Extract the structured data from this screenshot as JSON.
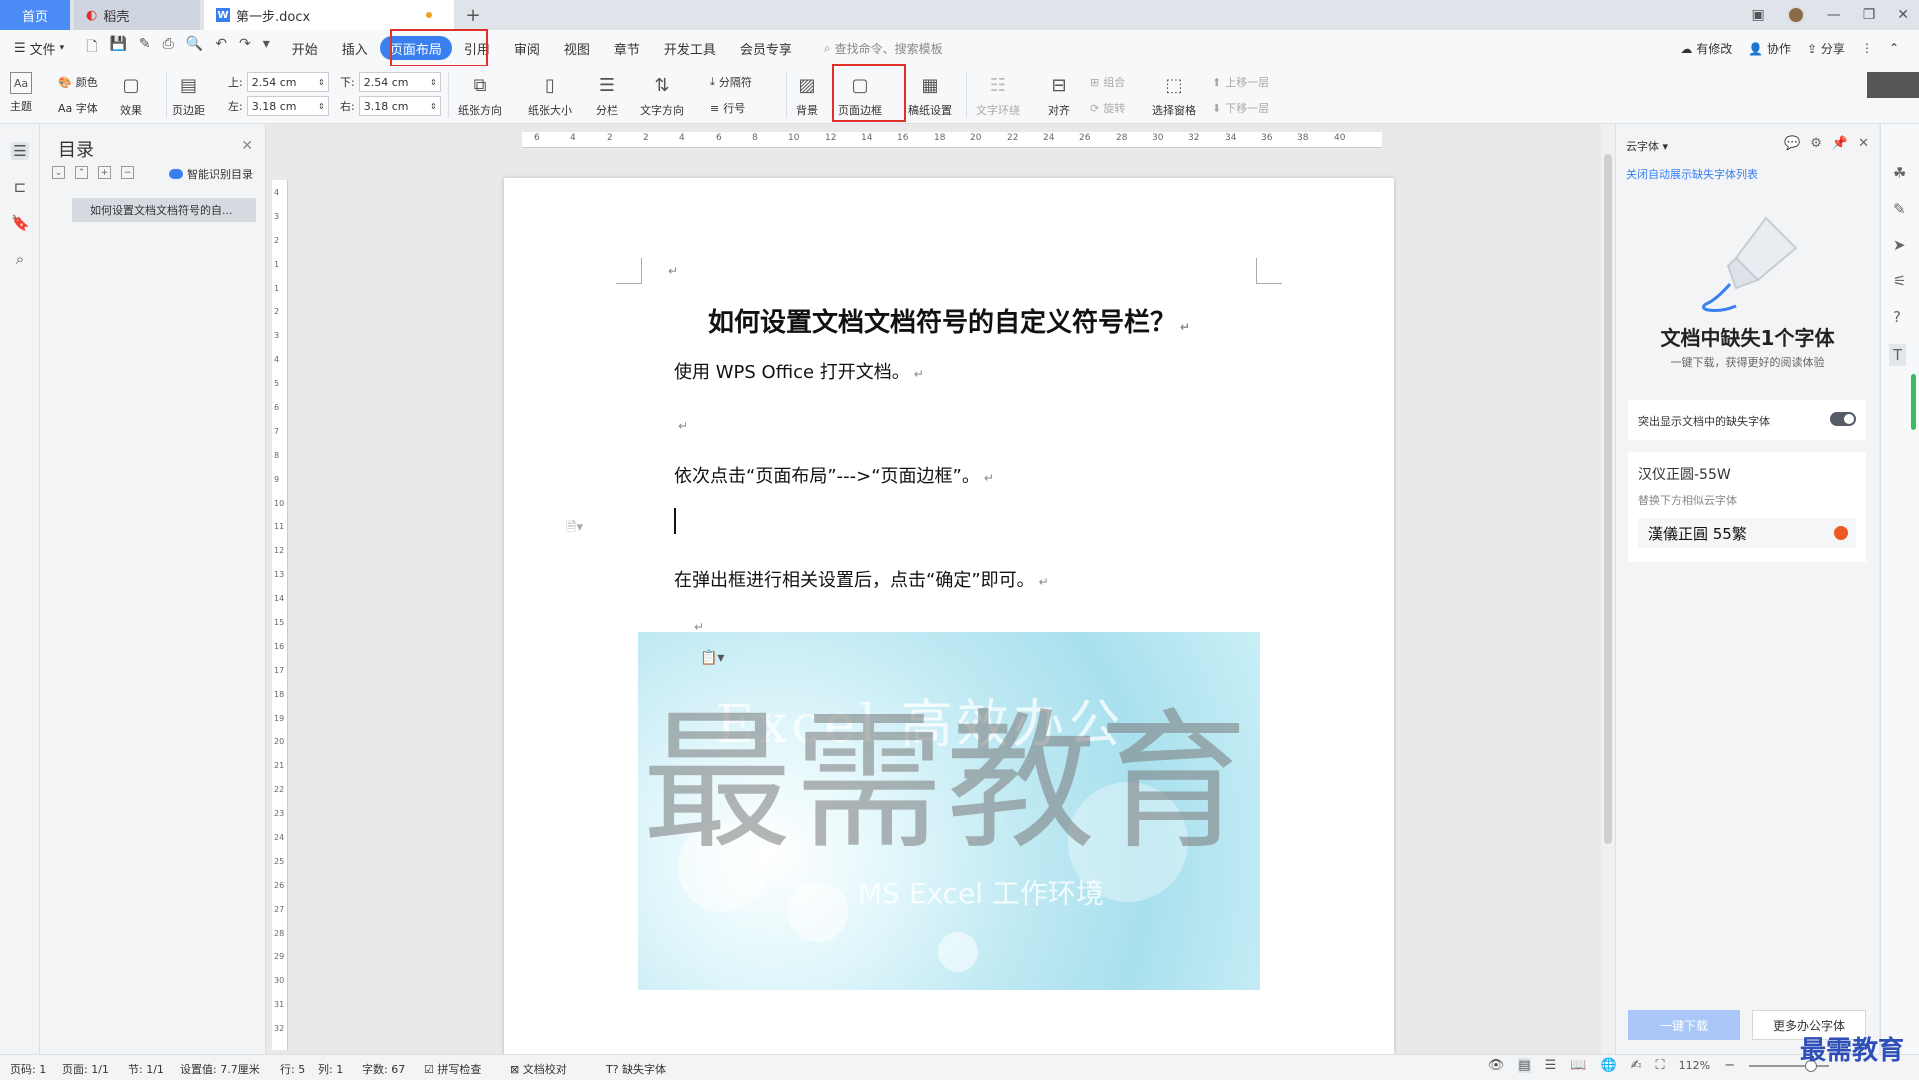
{
  "tabs": {
    "home": "首页",
    "daoke": "稻壳",
    "doc": "第一步.docx",
    "add": "+"
  },
  "menu": {
    "file": "文件",
    "items": [
      "开始",
      "插入",
      "页面布局",
      "引用",
      "审阅",
      "视图",
      "章节",
      "开发工具",
      "会员专享"
    ],
    "search": "查找命令、搜索模板",
    "modified": "有修改",
    "collab": "协作",
    "share": "分享"
  },
  "ribbon": {
    "theme": "主题",
    "color": "颜色",
    "font": "Aa 字体",
    "effect": "效果",
    "margins": "页边距",
    "top_label": "上:",
    "top_value": "2.54 cm",
    "bottom_label": "下:",
    "bottom_value": "2.54 cm",
    "left_label": "左:",
    "left_value": "3.18 cm",
    "right_label": "右:",
    "right_value": "3.18 cm",
    "orientation": "纸张方向",
    "size": "纸张大小",
    "columns": "分栏",
    "text_dir": "文字方向",
    "separator": "分隔符",
    "line_no": "行号",
    "background": "背景",
    "page_border": "页面边框",
    "manuscript": "稿纸设置",
    "wrap": "文字环绕",
    "align": "对齐",
    "group": "组合",
    "rotate": "旋转",
    "select_pane": "选择窗格",
    "bring_forward": "上移一层",
    "send_backward": "下移一层"
  },
  "toc": {
    "title": "目录",
    "smart": "智能识别目录",
    "entry": "如何设置文档文档符号的自..."
  },
  "ruler": {
    "h_ticks": [
      "6",
      "4",
      "2",
      "2",
      "4",
      "6",
      "8",
      "10",
      "12",
      "14",
      "16",
      "18",
      "20",
      "22",
      "24",
      "26",
      "28",
      "30",
      "32",
      "34",
      "36",
      "38",
      "40"
    ],
    "v_ticks": [
      "4",
      "3",
      "2",
      "1",
      "1",
      "2",
      "3",
      "4",
      "5",
      "6",
      "7",
      "8",
      "9",
      "10",
      "11",
      "12",
      "13",
      "14",
      "15",
      "16",
      "17",
      "18",
      "19",
      "20",
      "21",
      "22",
      "23",
      "24",
      "25",
      "26",
      "27",
      "28",
      "29",
      "30",
      "31",
      "32"
    ]
  },
  "doc": {
    "title": "如何设置文档文档符号的自定义符号栏？",
    "p1": "使用 WPS Office 打开文档。",
    "p2": "依次点击“页面布局”--->“页面边框”。",
    "p3": "在弹出框进行相关设置后，点击“确定”即可。",
    "ret": "↵",
    "banner_top": "Excel 高效办公",
    "banner_mid": "MS Excel 工作环境",
    "watermark": "最需教育"
  },
  "cloudfont": {
    "header": "云字体",
    "link": "关闭自动展示缺失字体列表",
    "headline": "文档中缺失1个字体",
    "sub": "一键下载，获得更好的阅读体验",
    "toggle_label": "突出显示文档中的缺失字体",
    "font_name": "汉仪正圆-55W",
    "replace_hint": "替换下方相似云字体",
    "candidate": "漢儀正圓 55繁",
    "download_btn": "一键下载",
    "more_btn": "更多办公字体"
  },
  "status": {
    "page_code": "页码: 1",
    "pages": "页面: 1/1",
    "section": "节: 1/1",
    "setting": "设置值: 7.7厘米",
    "row": "行: 5",
    "col": "列: 1",
    "words": "字数: 67",
    "spell": "拼写检查",
    "proof": "文档校对",
    "missing_font": "缺失字体",
    "zoom": "112%"
  },
  "brand": "最需教育",
  "colors": {
    "accent": "#3a7ff0",
    "highlight": "#e0302a"
  }
}
